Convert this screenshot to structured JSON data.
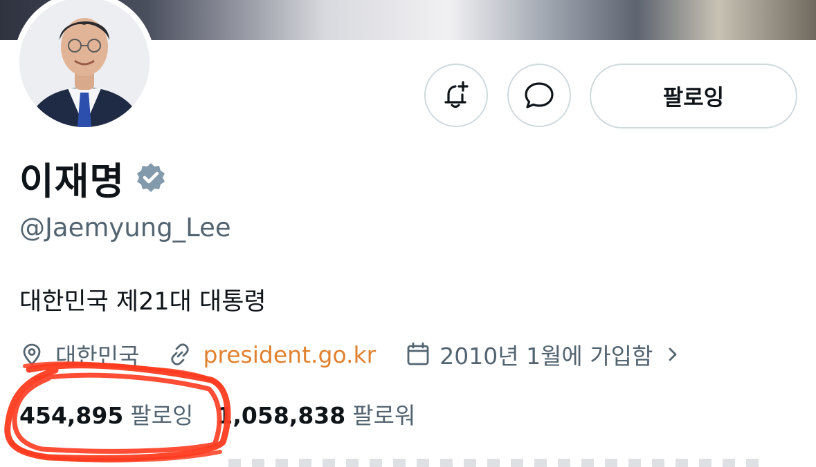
{
  "profile": {
    "name": "이재명",
    "handle": "@Jaemyung_Lee",
    "bio": "대한민국 제21대 대통령",
    "location": "대한민국",
    "website": "president.go.kr",
    "joined": "2010년 1월에 가입함"
  },
  "actions": {
    "follow_label": "팔로잉",
    "notify_icon": "bell-plus-icon",
    "message_icon": "message-bubble-icon"
  },
  "stats": {
    "following_count": "454,895",
    "following_label": "팔로잉",
    "followers_count": "1,058,838",
    "followers_label": "팔로워"
  },
  "colors": {
    "link": "#e0812f",
    "secondary_text": "#536471",
    "border": "#cfd9de",
    "verified_badge": "#829aab",
    "annotation_marker": "#ff3b1f"
  }
}
